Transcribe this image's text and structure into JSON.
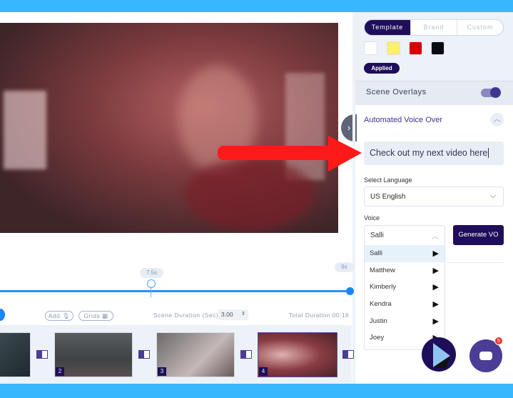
{
  "panel": {
    "color_tabs": [
      "Template",
      "Brand",
      "Custom"
    ],
    "active_tab": "Template",
    "swatches": [
      "#ffffff",
      "#fff06a",
      "#d40000",
      "#0a0a14"
    ],
    "applied_label": "Applied",
    "scene_overlays_label": "Scene Overlays",
    "scene_overlays_on": true,
    "voice_over_title": "Automated Voice Over",
    "voice_over_text": "Check out my next video here",
    "language_label": "Select Language",
    "language_value": "US English",
    "voice_label": "Voice",
    "voice_value": "Salli",
    "voice_options": [
      "Salli",
      "Matthew",
      "Kimberly",
      "Kendra",
      "Justin",
      "Joey"
    ],
    "generate_label": "Generate VO"
  },
  "timeline": {
    "marker_label": "7.5s",
    "end_label": "9s",
    "add_label": "Add",
    "grids_label": "Grids",
    "scene_duration_label": "Scene Duration (Sec)",
    "scene_duration_value": "3.00",
    "total_duration": "Total Duration:00:16",
    "scenes": [
      "2",
      "3",
      "4"
    ]
  },
  "chat_badge": "5",
  "colors": {
    "accent": "#38b6ff",
    "primary": "#1f0e5a",
    "arrow": "#ff1a1a"
  }
}
